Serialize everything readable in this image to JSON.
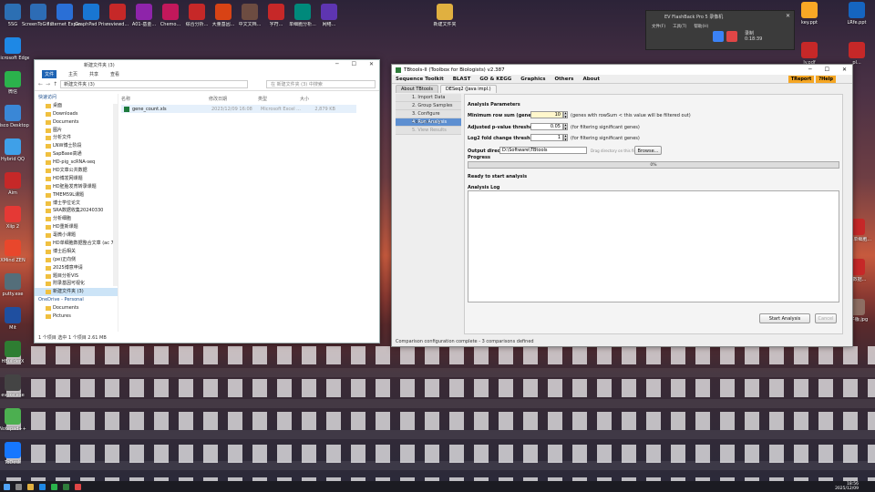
{
  "desktop": {
    "left_icons": [
      {
        "label": "5SG",
        "color": "#2c6fb3"
      },
      {
        "label": "Microsoft Edge",
        "color": "#1e88e5"
      },
      {
        "label": "微信",
        "color": "#2bb24c"
      },
      {
        "label": "Cisco Desktop",
        "color": "#3a87d6"
      },
      {
        "label": "Hybrid QQ",
        "color": "#3fa0e8"
      },
      {
        "label": "Aim",
        "color": "#c62828"
      },
      {
        "label": "Xiip 2",
        "color": "#e53935"
      },
      {
        "label": "XMind ZEN",
        "color": "#e8472c"
      },
      {
        "label": "putty.exe",
        "color": "#546e7a"
      },
      {
        "label": "Mit",
        "color": "#1f4fa0"
      },
      {
        "label": "HBuilderX",
        "color": "#2e7d32"
      },
      {
        "label": "evoke.exe",
        "color": "#444"
      },
      {
        "label": "Notepad++",
        "color": "#4caf50"
      },
      {
        "label": "ToDesk",
        "color": "#1677ff"
      }
    ],
    "top_icons": [
      {
        "label": "ScreenToGif 2.27",
        "color": "#2d6cb5"
      },
      {
        "label": "Internet Explorer",
        "color": "#2a6fd6"
      },
      {
        "label": "GraphPad Prism 8",
        "color": "#1976d2"
      },
      {
        "label": "reviewd...",
        "color": "#c62828"
      },
      {
        "label": "A01-基金...",
        "color": "#8e24aa"
      },
      {
        "label": "Chemo...",
        "color": "#c2185b"
      },
      {
        "label": "综合分析...",
        "color": "#c62828"
      },
      {
        "label": "大量基因...",
        "color": "#d84315"
      },
      {
        "label": "中文文档...",
        "color": "#6d4c41"
      },
      {
        "label": "字符...",
        "color": "#c62828"
      },
      {
        "label": "单细胞分析...",
        "color": "#00897b"
      },
      {
        "label": "网络...",
        "color": "#5e35b1"
      },
      {
        "label": "新建文件夹",
        "color": "#e0b040"
      }
    ],
    "right_icons": [
      {
        "label": "key.ppt",
        "color": "#f9a825"
      },
      {
        "label": "LRfe.ppt",
        "color": "#1565c0"
      },
      {
        "label": "ly.pdf",
        "color": "#c62828"
      },
      {
        "label": "pl...",
        "color": "#c62828"
      },
      {
        "label": "...xlsx",
        "color": "#2e7d32"
      },
      {
        "label": "ONE 单细胞...",
        "color": "#c62828"
      },
      {
        "label": "...sx",
        "color": "#2e7d32"
      },
      {
        "label": "C_数据...",
        "color": "#c62828"
      },
      {
        "label": "Mark...",
        "color": "#c62828"
      },
      {
        "label": "电子版.jpg",
        "color": "#8d6e63"
      }
    ]
  },
  "explorer": {
    "title": "新建文件夹 (3)",
    "ribbon": [
      "文件",
      "主页",
      "共享",
      "查看"
    ],
    "address": "新建文件夹 (3)",
    "search_placeholder": "在 新建文件夹 (3) 中搜索",
    "nav": [
      {
        "label": "快速访问",
        "top": true
      },
      {
        "label": "桌面"
      },
      {
        "label": "Downloads"
      },
      {
        "label": "Documents"
      },
      {
        "label": "图片"
      },
      {
        "label": "分析文件"
      },
      {
        "label": "LNW博士阶段"
      },
      {
        "label": "SapBase高通"
      },
      {
        "label": "HD-pig_scRNA-seq"
      },
      {
        "label": "HD文章公共数据"
      },
      {
        "label": "HD博发网课题"
      },
      {
        "label": "HD胚胎发育转录课题"
      },
      {
        "label": "TMEM59L课题"
      },
      {
        "label": "博士学位论文"
      },
      {
        "label": "SRA数据收集20240330"
      },
      {
        "label": "分析细胞"
      },
      {
        "label": "HD重新课题"
      },
      {
        "label": "毫微小课题"
      },
      {
        "label": "HD单细胞数据整合文章 (ac 7)"
      },
      {
        "label": "博士后相关"
      },
      {
        "label": "(pe)正向侧"
      },
      {
        "label": "2025博意申请"
      },
      {
        "label": "题目分析VIS"
      },
      {
        "label": "附录基因可视化"
      },
      {
        "label": "新建文件夹 (3)",
        "sel": true
      },
      {
        "label": "OneDrive - Personal",
        "top": true
      },
      {
        "label": "Documents"
      },
      {
        "label": "Pictures"
      }
    ],
    "columns": [
      "名称",
      "修改日期",
      "类型",
      "大小"
    ],
    "file": {
      "name": "gene_count.xls",
      "date": "2023/12/09 16:08",
      "type": "Microsoft Excel ...",
      "size": "2,879 KB"
    },
    "status": "1 个项目   选中 1 个项目  2.61 MB"
  },
  "tbtools": {
    "title": "TBtools-II (Toolbox for Biologists) v2.387",
    "menu": [
      "Sequence Toolkit",
      "BLAST",
      "GO & KEGG",
      "Graphics",
      "Others",
      "About"
    ],
    "menu_right": [
      "TReport",
      "?Help"
    ],
    "tabs": [
      "About TBtools",
      "DESeq2 (Java impl.)"
    ],
    "steps": [
      {
        "label": "1. Import Data",
        "state": "done"
      },
      {
        "label": "2. Group Samples",
        "state": "done"
      },
      {
        "label": "3. Configure Comparisons",
        "state": "done"
      },
      {
        "label": "4. Run Analysis",
        "state": "active"
      },
      {
        "label": "5. View Results",
        "state": "disabled"
      }
    ],
    "section_title": "Analysis Parameters",
    "params": [
      {
        "label": "Minimum row sum (gene filter):",
        "value": "10",
        "hint": "(genes with rowSum < this value will be filtered out)"
      },
      {
        "label": "Adjusted p-value threshold:",
        "value": "0.05",
        "hint": "(for filtering significant genes)"
      },
      {
        "label": "Log2 fold change threshold:",
        "value": "1",
        "hint": "(for filtering significant genes)"
      }
    ],
    "output_label": "Output directory:",
    "output_value": "D:\\Software\\TBtools",
    "output_hint": "Drag directory on this field",
    "browse": "Browse...",
    "progress_label": "Progress",
    "progress_pct": 0,
    "progress_text": "0%",
    "ready_text": "Ready to start analysis",
    "log_label": "Analysis Log",
    "start_btn": "Start Analysis",
    "cancel_btn": "Cancel",
    "status": "Comparison configuration complete - 3 comparisons defined"
  },
  "recorder": {
    "title": "EV FlashBack Pro 5 录像机",
    "menu": [
      "文件(F)",
      "工具(T)",
      "帮助(H)"
    ],
    "status_label": "录制",
    "time": "0:18:39"
  },
  "taskbar": {
    "time": "18:56",
    "date": "2025/12/09"
  }
}
